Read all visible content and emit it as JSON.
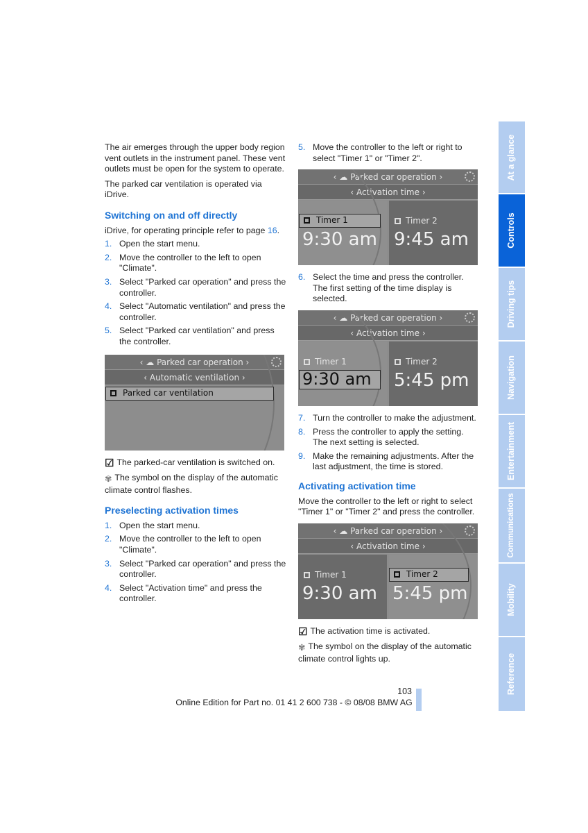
{
  "left": {
    "intro": [
      "The air emerges through the upper body region vent outlets in the instrument panel. These vent outlets must be open for the system to operate.",
      "The parked car ventilation is operated via iDrive."
    ],
    "h1": "Switching on and off directly",
    "ref_pre": "iDrive, for operating principle refer to page ",
    "ref_page": "16",
    "ref_post": ".",
    "steps1": [
      "Open the start menu.",
      "Move the controller to the left to open \"Climate\".",
      "Select \"Parked car operation\" and press the controller.",
      "Select \"Automatic ventilation\" and press the controller.",
      "Select \"Parked car ventilation\" and press the controller."
    ],
    "screen": {
      "title": "Parked car operation",
      "sub": "Automatic ventilation",
      "item": "Parked car ventilation"
    },
    "note1": "The parked-car ventilation is switched on.",
    "note2": "The symbol on the display of the automatic climate control flashes.",
    "h2": "Preselecting activation times",
    "steps2": [
      "Open the start menu.",
      "Move the controller to the left to open \"Climate\".",
      "Select \"Parked car operation\" and press the controller.",
      "Select \"Activation time\" and press the controller."
    ]
  },
  "right": {
    "step5": "Move the controller to the left or right to select \"Timer 1\" or \"Timer 2\".",
    "screen1": {
      "title": "Parked car operation",
      "sub": "Activation time",
      "t1": "Timer 1",
      "v1": "9:30 am",
      "t2": "Timer 2",
      "v2": "9:45 am"
    },
    "step6": "Select the time and press the controller. The first setting of the time display is selected.",
    "screen2": {
      "title": "Parked car operation",
      "sub": "Activation time",
      "t1": "Timer 1",
      "v1": "9:30 am",
      "t2": "Timer 2",
      "v2": "5:45 pm"
    },
    "steps": [
      "Turn the controller to make the adjustment.",
      "Press the controller to apply the setting. The next setting is selected.",
      "Make the remaining adjustments. After the last adjustment, the time is stored."
    ],
    "h": "Activating activation time",
    "para": "Move the controller to the left or right to select \"Timer 1\" or \"Timer 2\" and press the controller.",
    "screen3": {
      "title": "Parked car operation",
      "sub": "Activation time",
      "t1": "Timer 1",
      "v1": "9:30 am",
      "t2": "Timer 2",
      "v2": "5:45 pm"
    },
    "note1": "The activation time is activated.",
    "note2": "The symbol on the display of the automatic climate control lights up."
  },
  "tabs": [
    "At a glance",
    "Controls",
    "Driving tips",
    "Navigation",
    "Entertainment",
    "Communications",
    "Mobility",
    "Reference"
  ],
  "active_tab": "Controls",
  "footer": {
    "page": "103",
    "edition": "Online Edition for Part no. 01 41 2 600 738 - © 08/08 BMW AG"
  },
  "colors": {
    "accent": "#1f74d4",
    "tab_active": "#0a63d8",
    "tab": "#b3cdf0"
  }
}
